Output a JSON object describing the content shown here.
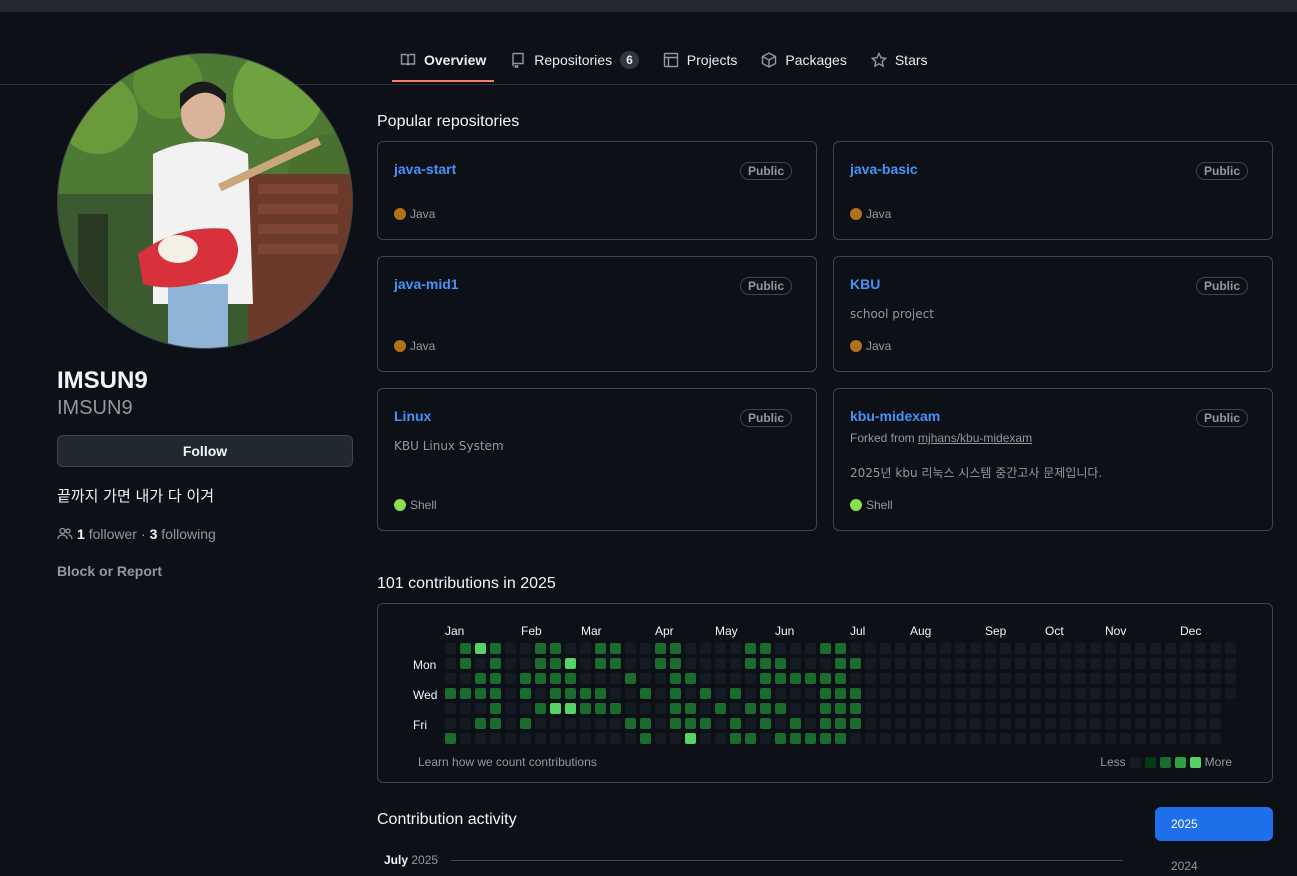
{
  "tabs": [
    {
      "label": "Overview",
      "icon": "book-icon"
    },
    {
      "label": "Repositories",
      "icon": "repo-icon",
      "count": "6"
    },
    {
      "label": "Projects",
      "icon": "table-icon"
    },
    {
      "label": "Packages",
      "icon": "package-icon"
    },
    {
      "label": "Stars",
      "icon": "star-icon"
    }
  ],
  "profile": {
    "name": "IMSUN9",
    "login": "IMSUN9",
    "follow_label": "Follow",
    "bio": "끝까지 가면 내가 다 이겨",
    "followers_count": "1",
    "followers_label": "follower",
    "following_count": "3",
    "following_label": "following",
    "separator": "·",
    "block_label": "Block or Report"
  },
  "popular": {
    "title": "Popular repositories",
    "repos": [
      {
        "name": "java-start",
        "badge": "Public",
        "desc": "",
        "lang": "Java",
        "color": "#b07219"
      },
      {
        "name": "java-basic",
        "badge": "Public",
        "desc": "",
        "lang": "Java",
        "color": "#b07219"
      },
      {
        "name": "java-mid1",
        "badge": "Public",
        "desc": "",
        "lang": "Java",
        "color": "#b07219"
      },
      {
        "name": "KBU",
        "badge": "Public",
        "desc": "school project",
        "lang": "Java",
        "color": "#b07219"
      },
      {
        "name": "Linux",
        "badge": "Public",
        "desc": "KBU Linux System",
        "lang": "Shell",
        "color": "#89e051"
      },
      {
        "name": "kbu-midexam",
        "badge": "Public",
        "fork_prefix": "Forked from",
        "fork_link": "mjhans/kbu-midexam",
        "desc": "2025년 kbu 리눅스 시스템 중간고사 문제입니다.",
        "lang": "Shell",
        "color": "#89e051"
      }
    ]
  },
  "contrib": {
    "title": "101 contributions in 2025",
    "months": [
      "Jan",
      "Feb",
      "Mar",
      "Apr",
      "May",
      "Jun",
      "Jul",
      "Aug",
      "Sep",
      "Oct",
      "Nov",
      "Dec"
    ],
    "days": [
      "Mon",
      "Wed",
      "Fri"
    ],
    "learn_label": "Learn how we count contributions",
    "less_label": "Less",
    "more_label": "More",
    "colors": [
      "#151b23",
      "#033a16",
      "#196c2e",
      "#2ea043",
      "#56d364"
    ]
  },
  "activity": {
    "title": "Contribution activity",
    "month": "July",
    "year": "2025",
    "years": [
      "2025",
      "2024"
    ]
  }
}
